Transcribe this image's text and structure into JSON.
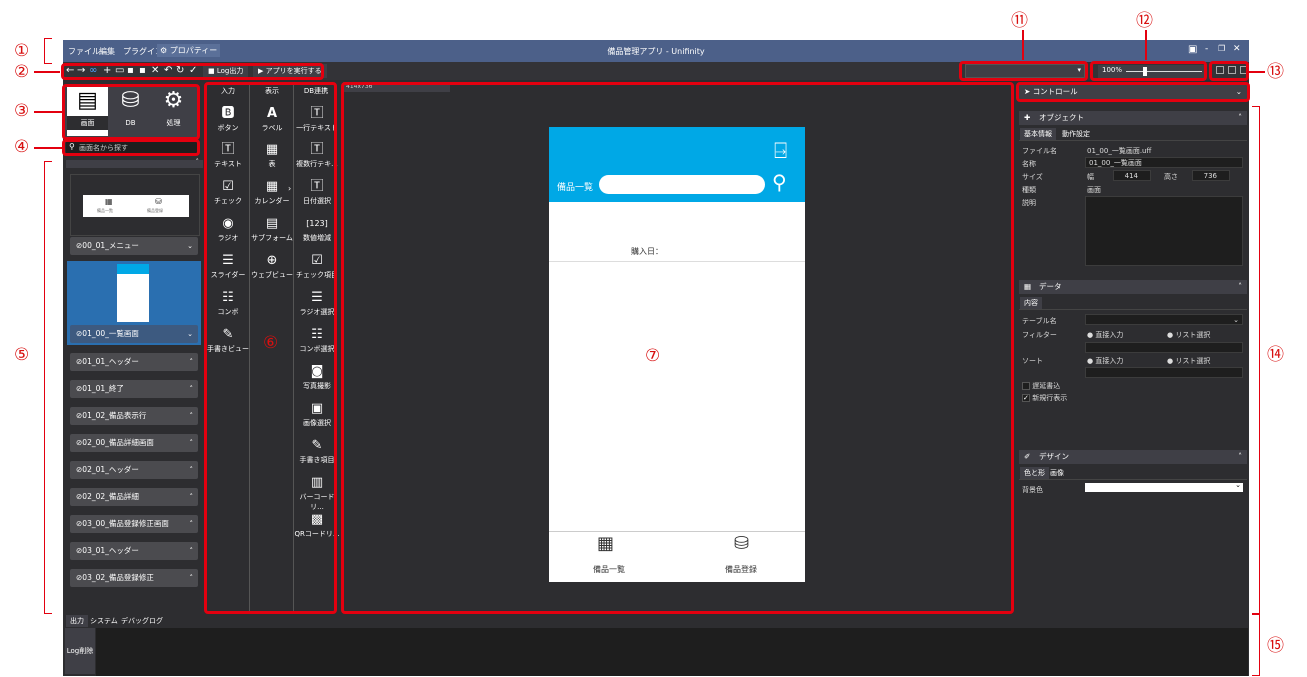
{
  "window": {
    "title": "備品管理アプリ - Unifinity"
  },
  "menu": {
    "items": [
      "ファイル",
      "編集",
      "プラグイン",
      "プロパティー"
    ]
  },
  "toolbar": {
    "log_output": "Log出力",
    "run_app": "アプリを実行する"
  },
  "zoom": {
    "level": "100%"
  },
  "screen_tabs": {
    "screen": "画面",
    "db": "DB",
    "process": "処理"
  },
  "search": {
    "placeholder": "画面名から探す"
  },
  "screens": [
    "00_01_メニュー",
    "01_00_一覧画面",
    "01_01_ヘッダー",
    "01_01_終了",
    "01_02_備品表示行",
    "02_00_備品詳細画面",
    "02_01_ヘッダー",
    "02_02_備品詳細",
    "03_00_備品登録修正画面",
    "03_01_ヘッダー",
    "03_02_備品登録修正"
  ],
  "thumb0": {
    "a": "備品一覧",
    "b": "備品登録"
  },
  "palette": {
    "input": {
      "title": "入力",
      "items": [
        "ボタン",
        "テキスト",
        "チェック",
        "ラジオ",
        "スライダー",
        "コンボ",
        "手書きビュー"
      ]
    },
    "display": {
      "title": "表示",
      "items": [
        "ラベル",
        "表",
        "カレンダー",
        "サブフォーム",
        "ウェブビュー"
      ]
    },
    "db": {
      "title": "DB連携",
      "items": [
        "一行テキスト",
        "複数行テキ...",
        "日付選択",
        "数値増減",
        "チェック項目",
        "ラジオ選択",
        "コンボ選択",
        "写真撮影",
        "画像選択",
        "手書き項目",
        "バーコードリ...",
        "QRコードリ..."
      ]
    }
  },
  "canvas": {
    "tab": "414x736"
  },
  "phone": {
    "header_title": "備品一覧",
    "purchase_label": "購入日：",
    "footer_list": "備品一覧",
    "footer_register": "備品登録"
  },
  "control_panel": {
    "title": "コントロール"
  },
  "object_panel": {
    "title": "オブジェクト",
    "tabs": [
      "基本情報",
      "動作設定"
    ],
    "file_label": "ファイル名",
    "file_value": "01_00_一覧画面.uff",
    "name_label": "名称",
    "name_value": "01_00_一覧画面",
    "size_label": "サイズ",
    "width_label": "幅",
    "width_value": "414",
    "height_label": "高さ",
    "height_value": "736",
    "type_label": "種類",
    "type_value": "画面",
    "desc_label": "説明"
  },
  "data_panel": {
    "title": "データ",
    "tab": "内容",
    "table_label": "テーブル名",
    "filter_label": "フィルター",
    "sort_label": "ソート",
    "direct_input": "直接入力",
    "list_select": "リスト選択",
    "lazy_load": "遅延書込",
    "new_row": "新規行表示"
  },
  "design_panel": {
    "title": "デザイン",
    "tabs": [
      "色と形",
      "画像"
    ],
    "bg_label": "背景色"
  },
  "bottom": {
    "tabs": [
      "出力",
      "システム",
      "デバッグログ"
    ],
    "clear_log": "Log削除"
  },
  "callouts": [
    "①",
    "②",
    "③",
    "④",
    "⑤",
    "⑥",
    "⑦",
    "⑪",
    "⑫",
    "⑬",
    "⑭",
    "⑮"
  ],
  "colors": {
    "accent_red": "#e3000f",
    "title_bar": "#4c6089",
    "phone_header": "#00a8e6",
    "selected": "#2a6fb0"
  }
}
